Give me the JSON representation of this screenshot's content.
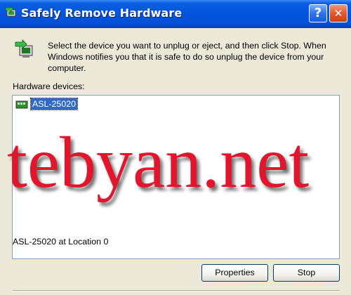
{
  "window": {
    "title": "Safely Remove Hardware",
    "help_label": "?",
    "close_label": "✕"
  },
  "instruction": "Select the device you want to unplug or eject, and then click Stop. When Windows notifies you that it is safe to do so unplug the device from your computer.",
  "hardware_devices_label": "Hardware devices:",
  "devices": [
    {
      "label": "ASL-25020",
      "selected": true,
      "icon": "usb-device-icon"
    }
  ],
  "watermark": "tebyan.net",
  "location_text": "ASL-25020 at Location 0",
  "buttons": {
    "properties": "Properties",
    "stop": "Stop"
  },
  "colors": {
    "titlebar": "#0453dc",
    "selection": "#316ac5",
    "watermark": "#e2152c",
    "dialog_bg": "#ece9d8"
  }
}
